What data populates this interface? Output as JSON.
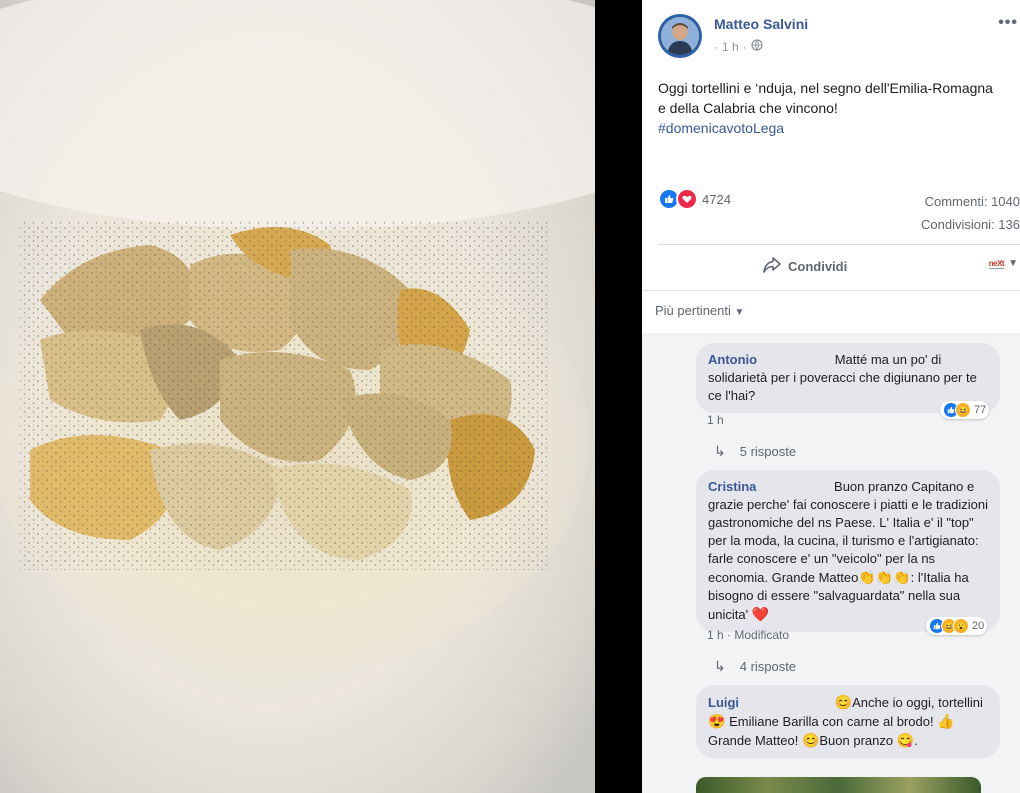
{
  "post": {
    "author": "Matteo Salvini",
    "time": "1 h",
    "text": "Oggi tortellini e ‘nduja, nel segno dell'Emilia-Romagna e della Calabria che vincono!",
    "hashtag": "#domenicavotoLega",
    "reaction_count": "4724",
    "comments_stat": "Commenti: 1040",
    "shares_stat": "Condivisioni: 136",
    "share_label": "Condividi",
    "page_badge": "neXt"
  },
  "filter": {
    "label": "Più pertinenti"
  },
  "comments": [
    {
      "author": "Antonio",
      "text": "Matté ma un po' di solidarietà per i poveracci che digiunano per te ce l'hai?",
      "time": "1 h",
      "reaction_count": "77",
      "replies": "5 risposte"
    },
    {
      "author": "Cristina",
      "text_part1": "Buon pranzo Capitano e grazie perche' fai conoscere i piatti e le tradizioni gastronomiche del ns Paese. L' Italia e' il \"top\" per la moda, la cucina, il turismo e l'artigianato: farle conoscere e' un \"veicolo\" per la ns economia. Grande Matteo",
      "text_part2": ": l'Italia ha bisogno di essere \"salvaguardata\" nella sua unicita'",
      "time": "1 h",
      "edited": "Modificato",
      "reaction_count": "20",
      "replies": "4 risposte"
    },
    {
      "author": "Luigi",
      "text_part1": "Anche io oggi, tortellini",
      "text_part2": "Emiliane Barilla con carne al brodo!",
      "text_part3": "Grande Matteo!",
      "text_part4": "Buon pranzo",
      "text_part5": "."
    }
  ],
  "icons": {
    "globe": "globe-icon",
    "share": "share-icon",
    "more": "more-icon"
  },
  "colors": {
    "link": "#385898",
    "like": "#1877f2",
    "love": "#f0284a",
    "bubble": "#e4e6eb",
    "muted": "#606770"
  }
}
